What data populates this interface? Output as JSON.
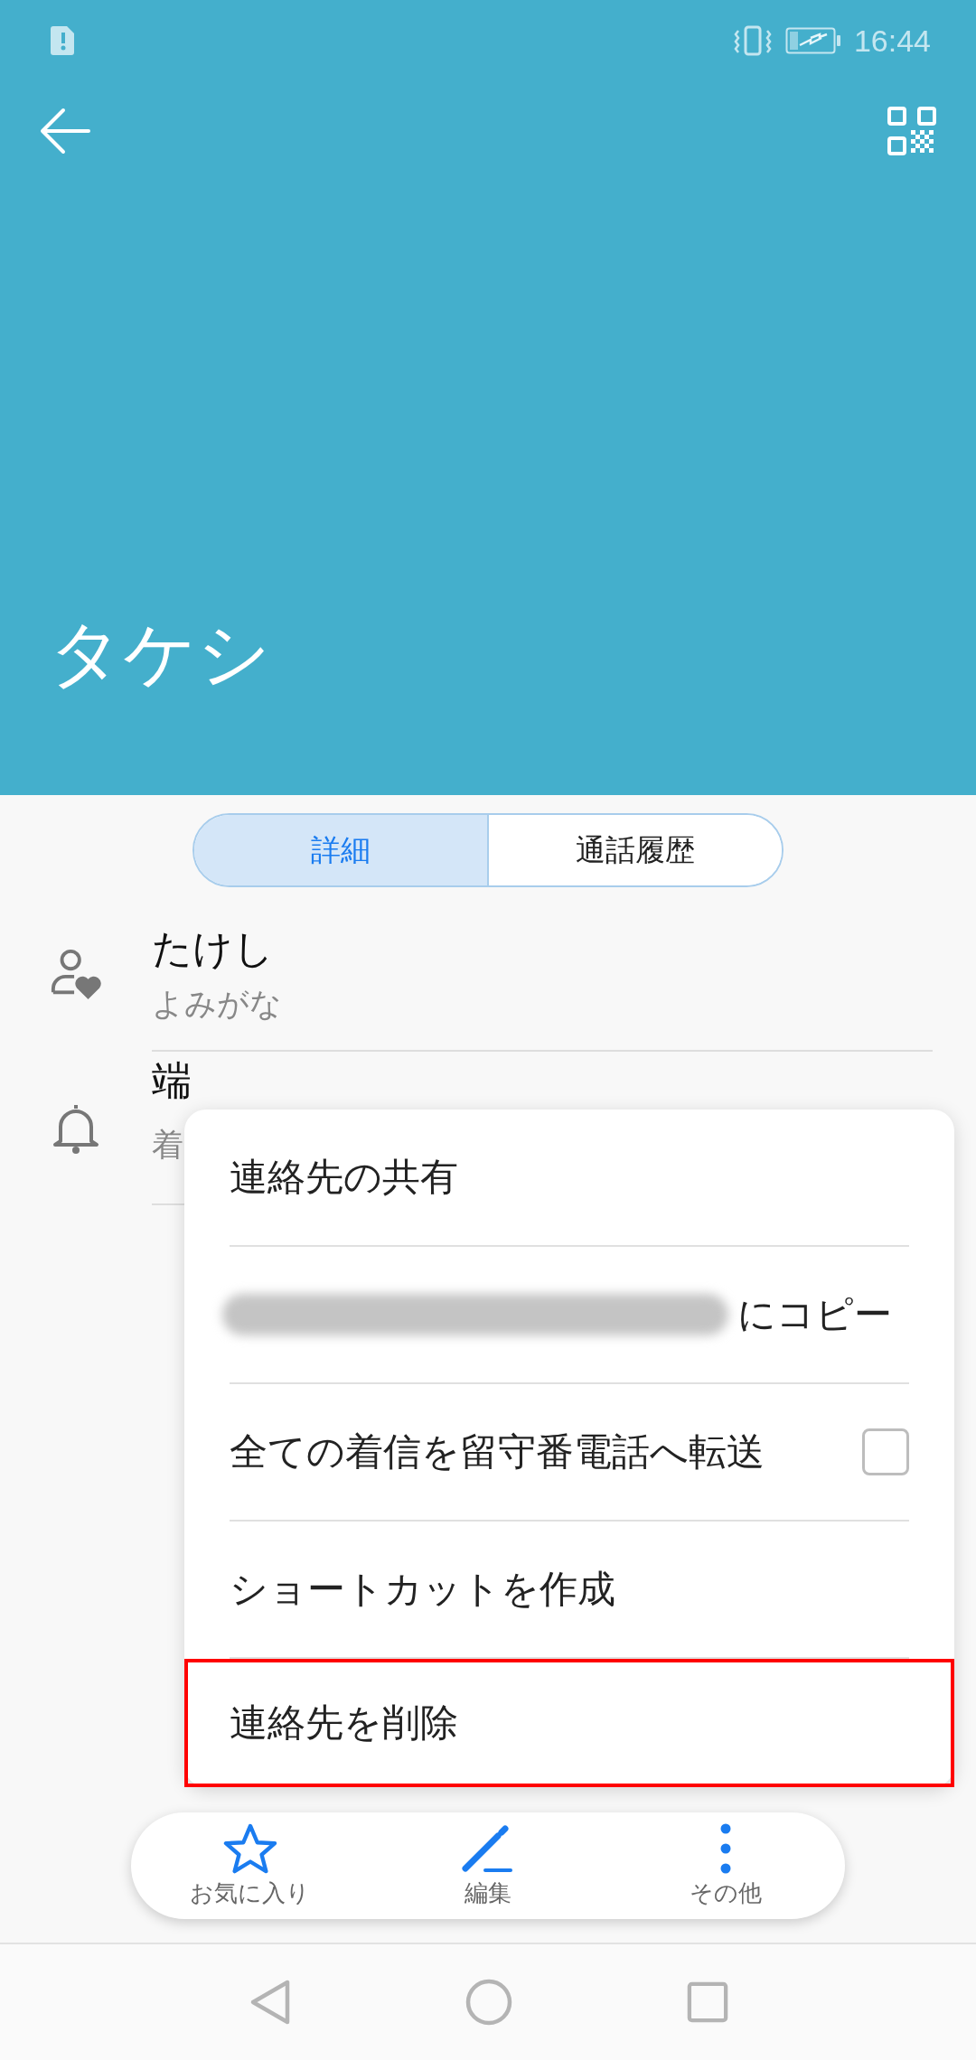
{
  "status_bar": {
    "time": "16:44"
  },
  "header": {
    "title": "タケシ"
  },
  "tabs": [
    {
      "label": "詳細",
      "selected": true
    },
    {
      "label": "通話履歴",
      "selected": false
    }
  ],
  "fields": [
    {
      "kind": "person",
      "title": "たけし",
      "subtitle": "よみがな"
    },
    {
      "kind": "ringtone",
      "title": "端",
      "subtitle": "着"
    }
  ],
  "menu": {
    "items": [
      {
        "kind": "plain",
        "label": "連絡先の共有",
        "highlighted": false
      },
      {
        "kind": "copy",
        "label": "にコピー",
        "highlighted": false
      },
      {
        "kind": "checkbox",
        "label": "全ての着信を留守番電話へ転送",
        "checked": false,
        "highlighted": false
      },
      {
        "kind": "plain",
        "label": "ショートカットを作成",
        "highlighted": false
      },
      {
        "kind": "plain",
        "label": "連絡先を削除",
        "highlighted": true
      }
    ]
  },
  "actions": [
    {
      "kind": "star",
      "label": "お気に入り"
    },
    {
      "kind": "edit",
      "label": "編集"
    },
    {
      "kind": "more",
      "label": "その他"
    }
  ]
}
